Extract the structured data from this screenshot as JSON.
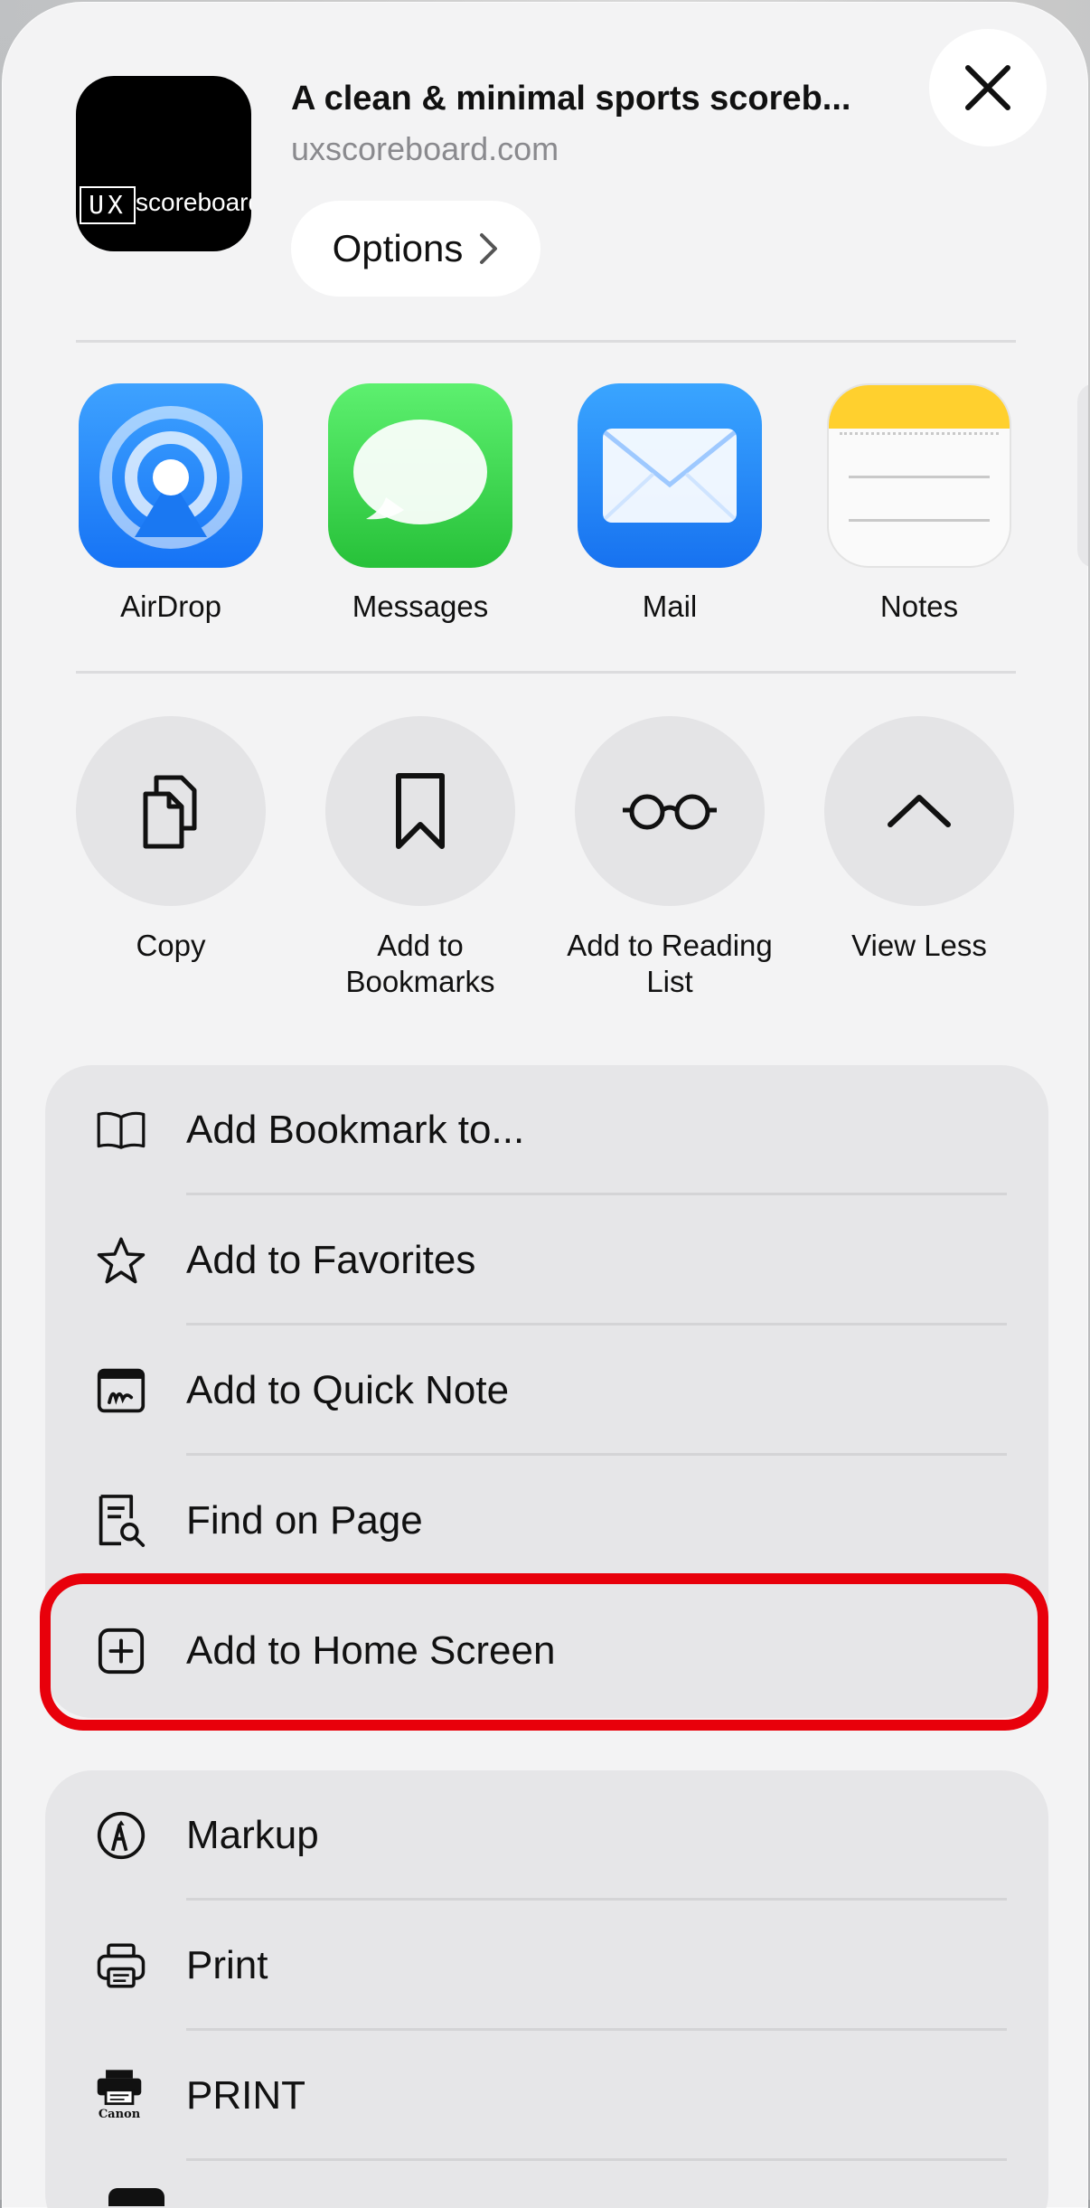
{
  "header": {
    "app_icon": {
      "ux_text": "UX",
      "brand_text": "scoreboard"
    },
    "title": "A clean & minimal sports scoreb...",
    "url": "uxscoreboard.com",
    "options_label": "Options",
    "close_icon": "close-icon"
  },
  "share_targets": [
    {
      "label": "AirDrop",
      "icon": "airdrop-icon"
    },
    {
      "label": "Messages",
      "icon": "messages-icon"
    },
    {
      "label": "Mail",
      "icon": "mail-icon"
    },
    {
      "label": "Notes",
      "icon": "notes-icon"
    }
  ],
  "actions": [
    {
      "label": "Copy",
      "icon": "copy-icon"
    },
    {
      "label": "Add to\nBookmarks",
      "icon": "bookmark-icon"
    },
    {
      "label": "Add to Reading\nList",
      "icon": "glasses-icon"
    },
    {
      "label": "View Less",
      "icon": "chevron-up-icon"
    }
  ],
  "menu_group_1": [
    {
      "label": "Add Bookmark to...",
      "icon": "open-book-icon"
    },
    {
      "label": "Add to Favorites",
      "icon": "star-icon"
    },
    {
      "label": "Add to Quick Note",
      "icon": "quick-note-icon"
    },
    {
      "label": "Find on Page",
      "icon": "find-on-page-icon"
    },
    {
      "label": "Add to Home Screen",
      "icon": "plus-square-icon",
      "highlighted": true
    }
  ],
  "menu_group_2": [
    {
      "label": "Markup",
      "icon": "markup-icon"
    },
    {
      "label": "Print",
      "icon": "printer-icon"
    },
    {
      "label": "PRINT",
      "icon": "canon-printer-icon",
      "icon_text": "Canon"
    }
  ],
  "colors": {
    "highlight": "#e8000b",
    "sheet_bg": "#f3f3f4",
    "group_bg": "#e6e6e8"
  }
}
